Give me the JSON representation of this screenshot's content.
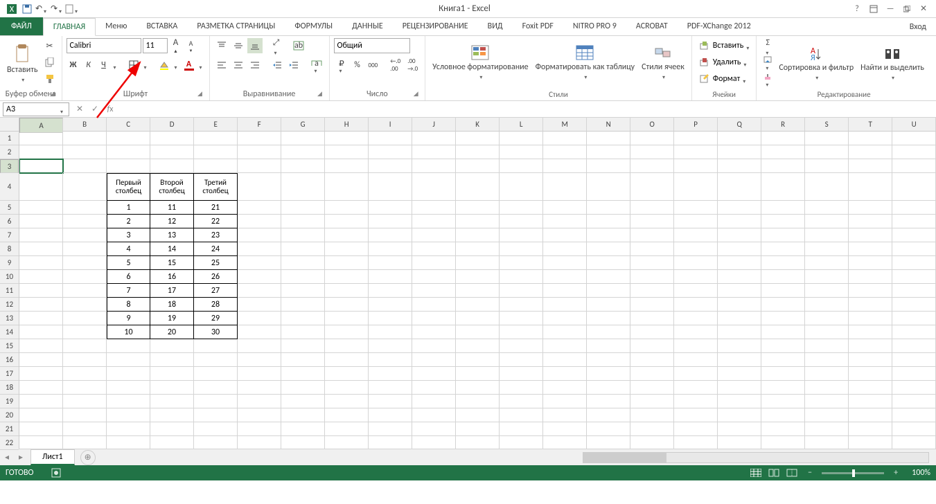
{
  "app_title": "Книга1 - Excel",
  "tabs": {
    "file": "ФАЙЛ",
    "list": [
      "ГЛАВНАЯ",
      "Меню",
      "ВСТАВКА",
      "РАЗМЕТКА СТРАНИЦЫ",
      "ФОРМУЛЫ",
      "ДАННЫЕ",
      "РЕЦЕНЗИРОВАНИЕ",
      "ВИД",
      "Foxit PDF",
      "NITRO PRO 9",
      "ACROBAT",
      "PDF-XChange 2012"
    ],
    "active": 0,
    "signin": "Вход"
  },
  "ribbon": {
    "clipboard": {
      "paste": "Вставить",
      "label": "Буфер обмена"
    },
    "font": {
      "name": "Calibri",
      "size": "11",
      "label": "Шрифт",
      "bold": "Ж",
      "italic": "К",
      "underline": "Ч"
    },
    "align": {
      "label": "Выравнивание"
    },
    "number": {
      "format": "Общий",
      "label": "Число"
    },
    "styles": {
      "cond": "Условное форматирование",
      "astable": "Форматировать как таблицу",
      "cellstyles": "Стили ячеек",
      "label": "Стили"
    },
    "cells": {
      "insert": "Вставить",
      "delete": "Удалить",
      "fmt": "Формат",
      "label": "Ячейки"
    },
    "edit": {
      "sort": "Сортировка и фильтр",
      "find": "Найти и выделить",
      "label": "Редактирование"
    }
  },
  "fx": {
    "namebox": "A3",
    "formula": ""
  },
  "columns": [
    "A",
    "B",
    "C",
    "D",
    "E",
    "F",
    "G",
    "H",
    "I",
    "J",
    "K",
    "L",
    "M",
    "N",
    "O",
    "P",
    "Q",
    "R",
    "S",
    "T",
    "U"
  ],
  "rows": [
    1,
    2,
    3,
    4,
    5,
    6,
    7,
    8,
    9,
    10,
    11,
    12,
    13,
    14,
    15,
    16,
    17,
    18,
    19,
    20,
    21,
    22
  ],
  "active_cell": {
    "row": 3,
    "col": "A"
  },
  "table": {
    "headers": [
      "Первый столбец",
      "Второй столбец",
      "Третий столбец"
    ],
    "data": [
      [
        1,
        11,
        21
      ],
      [
        2,
        12,
        22
      ],
      [
        3,
        13,
        23
      ],
      [
        4,
        14,
        24
      ],
      [
        5,
        15,
        25
      ],
      [
        6,
        16,
        26
      ],
      [
        7,
        17,
        27
      ],
      [
        8,
        18,
        28
      ],
      [
        9,
        19,
        29
      ],
      [
        10,
        20,
        30
      ]
    ]
  },
  "sheet": {
    "name": "Лист1"
  },
  "status": {
    "ready": "ГОТОВО",
    "zoom": "100%"
  }
}
